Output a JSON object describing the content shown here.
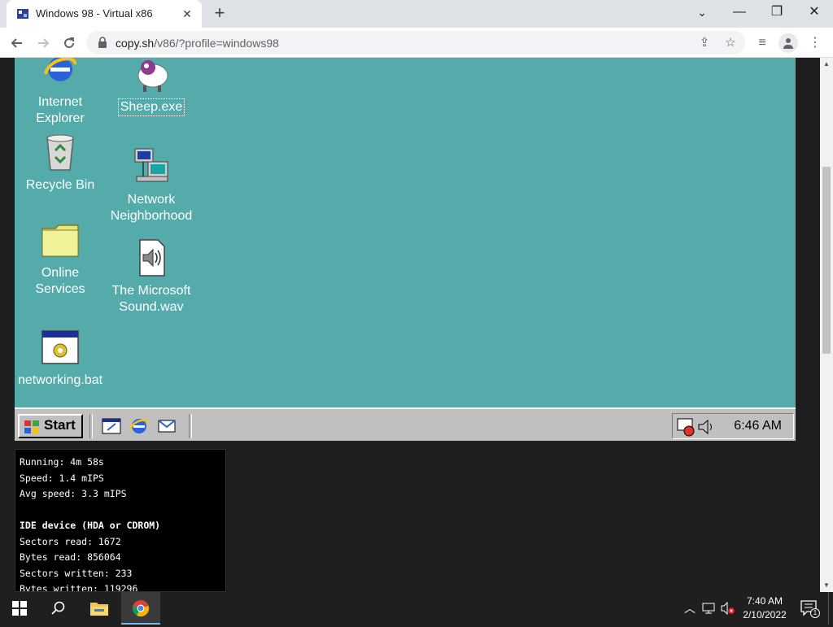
{
  "browser": {
    "tab": {
      "title": "Windows 98 - Virtual x86",
      "close": "✕"
    },
    "new_tab": "+",
    "window_controls": {
      "minimize": "—",
      "restore": "❐",
      "close": "✕",
      "tab_search": "⌄"
    },
    "url": {
      "host": "copy.sh",
      "path": "/v86/?profile=windows98"
    }
  },
  "desktop": {
    "icons": [
      {
        "label": "Internet\nExplorer"
      },
      {
        "label": "Sheep.exe"
      },
      {
        "label": "Recycle Bin"
      },
      {
        "label": "Network\nNeighborhood"
      },
      {
        "label": "Online\nServices"
      },
      {
        "label": "The Microsoft\nSound.wav"
      },
      {
        "label": "networking.bat"
      }
    ],
    "colors": {
      "background": "#55aaaa",
      "taskbar": "#c0c0c0"
    }
  },
  "taskbar98": {
    "start_label": "Start",
    "clock": "6:46 AM"
  },
  "stats": {
    "running": "Running: 4m 58s",
    "speed": "Speed: 1.4 mIPS",
    "avg_speed": "Avg speed: 3.3 mIPS",
    "ide_header": "IDE device (HDA or CDROM)",
    "sectors_read": "Sectors read: 1672",
    "bytes_read": "Bytes read: 856064",
    "sectors_written": "Sectors written: 233",
    "bytes_written": "Bytes written: 119296"
  },
  "win10": {
    "clock_time": "7:40 AM",
    "clock_date": "2/10/2022",
    "notification_count": "1"
  }
}
